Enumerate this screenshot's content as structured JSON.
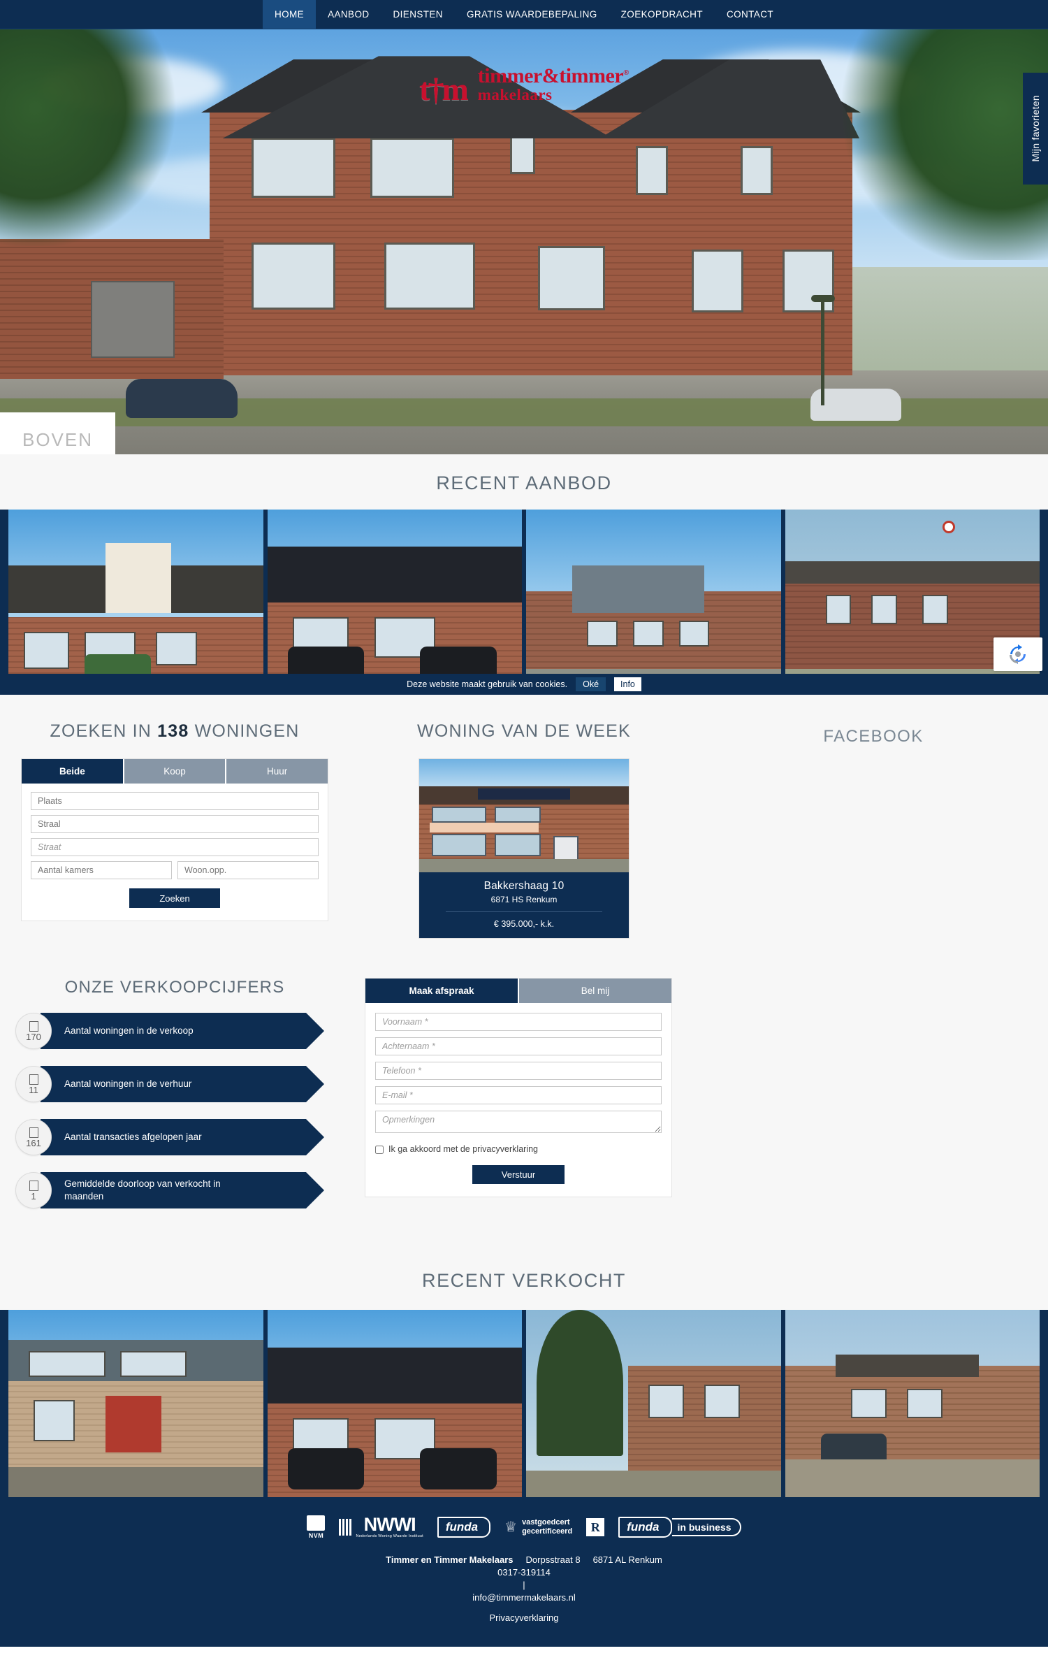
{
  "nav": {
    "items": [
      {
        "label": "HOME",
        "active": true
      },
      {
        "label": "AANBOD",
        "active": false
      },
      {
        "label": "DIENSTEN",
        "active": false
      },
      {
        "label": "GRATIS WAARDEBEPALING",
        "active": false
      },
      {
        "label": "ZOEKOPDRACHT",
        "active": false
      },
      {
        "label": "CONTACT",
        "active": false
      }
    ]
  },
  "hero": {
    "logo_mark": "t†m",
    "logo_name": "timmer&timmer",
    "logo_reg": "®",
    "logo_sub": "makelaars",
    "favorites_tab": "Mijn favorieten",
    "banner_text": "BOVEN"
  },
  "recent_aanbod": {
    "title": "RECENT AANBOD",
    "items": [
      {
        "name": "listing-photo-1"
      },
      {
        "name": "listing-photo-2"
      },
      {
        "name": "listing-photo-3"
      },
      {
        "name": "listing-photo-4"
      }
    ]
  },
  "cookie": {
    "text": "Deze website maakt gebruik van cookies.",
    "ok_label": "Oké",
    "info_label": "Info"
  },
  "search": {
    "title_pre": "ZOEKEN IN",
    "count": "138",
    "title_post": "WONINGEN",
    "tabs": [
      {
        "label": "Beide",
        "active": true
      },
      {
        "label": "Koop",
        "active": false
      },
      {
        "label": "Huur",
        "active": false
      }
    ],
    "fields": [
      {
        "name": "plaats",
        "placeholder": "Plaats",
        "value": ""
      },
      {
        "name": "straal",
        "placeholder": "Straal",
        "value": ""
      },
      {
        "name": "straat",
        "placeholder": "Straat",
        "value": ""
      },
      {
        "name": "aantal-kamers",
        "placeholder": "Aantal kamers",
        "value": ""
      },
      {
        "name": "woonopp",
        "placeholder": "Woon.opp.",
        "value": ""
      }
    ],
    "submit_label": "Zoeken"
  },
  "week": {
    "title": "WONING VAN DE WEEK",
    "address": "Bakkershaag 10",
    "zip_city": "6871 HS Renkum",
    "price": "€ 395.000,- k.k."
  },
  "facebook": {
    "title": "FACEBOOK"
  },
  "stats": {
    "title": "ONZE VERKOOPCIJFERS",
    "items": [
      {
        "value": "170",
        "label": "Aantal woningen in de verkoop"
      },
      {
        "value": "11",
        "label": "Aantal woningen in de verhuur"
      },
      {
        "value": "161",
        "label": "Aantal transacties afgelopen jaar"
      },
      {
        "value": "1",
        "label": "Gemiddelde doorloop van verkocht in maanden"
      }
    ]
  },
  "contact_form": {
    "tabs": [
      {
        "label": "Maak afspraak",
        "active": true
      },
      {
        "label": "Bel mij",
        "active": false
      }
    ],
    "fields": [
      {
        "name": "voornaam",
        "placeholder": "Voornaam *",
        "value": ""
      },
      {
        "name": "achternaam",
        "placeholder": "Achternaam *",
        "value": ""
      },
      {
        "name": "telefoon",
        "placeholder": "Telefoon *",
        "value": ""
      },
      {
        "name": "email",
        "placeholder": "E-mail *",
        "value": ""
      }
    ],
    "textarea": {
      "name": "opmerkingen",
      "placeholder": "Opmerkingen",
      "value": ""
    },
    "consent_label": "Ik ga akkoord met de privacyverklaring",
    "consent_checked": false,
    "submit_label": "Verstuur"
  },
  "recent_verkocht": {
    "title": "RECENT VERKOCHT",
    "items": [
      {
        "name": "sold-photo-1"
      },
      {
        "name": "sold-photo-2"
      },
      {
        "name": "sold-photo-3"
      },
      {
        "name": "sold-photo-4"
      }
    ]
  },
  "footer": {
    "logos": [
      {
        "id": "nvm",
        "label": "NVM"
      },
      {
        "id": "nwwi",
        "label": "NWWI",
        "sub": "Nederlands Woning Waarde Instituut"
      },
      {
        "id": "funda",
        "label": "funda"
      },
      {
        "id": "vastgoedcert",
        "label": "vastgoedcert",
        "label2": "gecertificeerd"
      },
      {
        "id": "register-makelaar",
        "label": "R"
      },
      {
        "id": "funda-in-business",
        "label": "funda",
        "label2": "in business"
      }
    ],
    "company": "Timmer en Timmer Makelaars",
    "street": "Dorpsstraat 8",
    "zip_city": "6871 AL Renkum",
    "phone": "0317-319114",
    "divider": "|",
    "email": "info@timmermakelaars.nl",
    "privacy": "Privacyverklaring"
  },
  "colors": {
    "navy": "#0d2d52",
    "navy_light": "#1a4c80",
    "slate": "#8796a6",
    "logo_red": "#c8102e",
    "page_bg": "#f7f7f7"
  }
}
